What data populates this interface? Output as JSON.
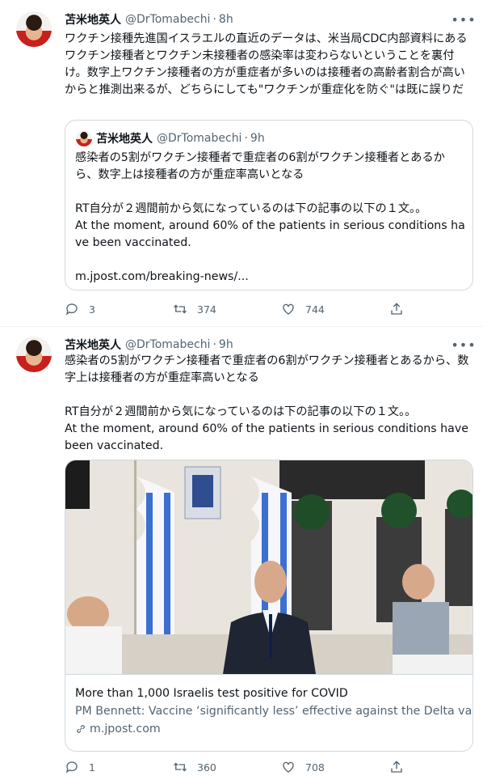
{
  "colors": {
    "text": "#0f1419",
    "secondary": "#536471",
    "border": "#cfd9de"
  },
  "tweets": [
    {
      "author": {
        "name": "苫米地英人",
        "handle": "@DrTomabechi",
        "time": "8h"
      },
      "text": "ワクチン接種先進国イスラエルの直近のデータは、米当局CDC内部資料にあるワクチン接種者とワクチン未接種者の感染率は変わらないということを裏付け。数字上ワクチン接種者の方が重症者が多いのは接種者の高齢者割合が高いからと推測出来るが、どちらにしても\"ワクチンが重症化を防ぐ\"は既に誤りだ",
      "quote": {
        "author": {
          "name": "苫米地英人",
          "handle": "@DrTomabechi",
          "time": "9h"
        },
        "text": "感染者の5割がワクチン接種者で重症者の6割がワクチン接種者とあるから、数字上は接種者の方が重症率高いとなる\n\nRT自分が２週間前から気になっているのは下の記事の以下の１文。。\nAt the moment, around 60% of the patients in serious conditions have been vaccinated.\n\nm.jpost.com/breaking-news/..."
      },
      "stats": {
        "replies": "3",
        "retweets": "374",
        "likes": "744"
      },
      "icons": [
        "reply-icon",
        "retweet-icon",
        "like-icon",
        "share-icon"
      ]
    },
    {
      "author": {
        "name": "苫米地英人",
        "handle": "@DrTomabechi",
        "time": "9h"
      },
      "text": "感染者の5割がワクチン接種者で重症者の6割がワクチン接種者とあるから、数字上は接種者の方が重症率高いとなる\n\nRT自分が２週間前から気になっているのは下の記事の以下の１文。。\nAt the moment, around 60% of the patients in serious conditions have been vaccinated.",
      "card": {
        "title": "More than 1,000 Israelis test positive for COVID",
        "description": "PM Bennett: Vaccine ‘significantly less’ effective against the Delta variant",
        "domain": "m.jpost.com"
      },
      "stats": {
        "replies": "1",
        "retweets": "360",
        "likes": "708"
      },
      "icons": [
        "reply-icon",
        "retweet-icon",
        "like-icon",
        "share-icon"
      ]
    }
  ]
}
